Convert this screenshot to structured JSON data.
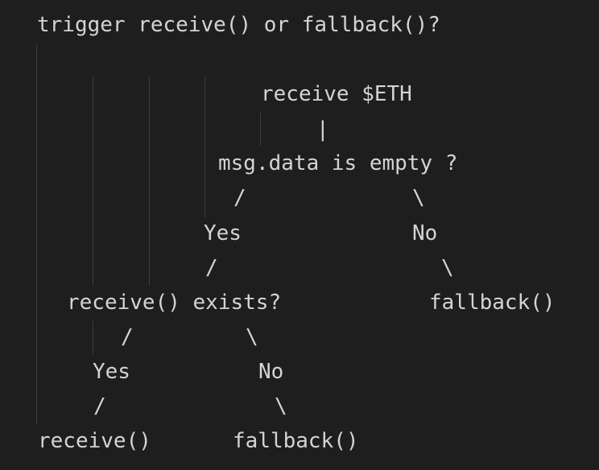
{
  "title": "trigger receive() or fallback()?",
  "nodes": {
    "receive_eth": "receive $ETH",
    "pipe": "|",
    "msg_data_question": "msg.data is empty ?",
    "yes_1": "Yes",
    "no_1": "No",
    "receive_exists_question": "receive() exists?",
    "fallback_1": "fallback()",
    "yes_2": "Yes",
    "no_2": "No",
    "receive_result": "receive()",
    "fallback_2": "fallback()"
  },
  "connectors": {
    "slash": "/",
    "backslash": "\\"
  },
  "colors": {
    "background": "#1e1e1e",
    "text": "#d4d4d4",
    "indent_guide": "#3c3c3c"
  }
}
